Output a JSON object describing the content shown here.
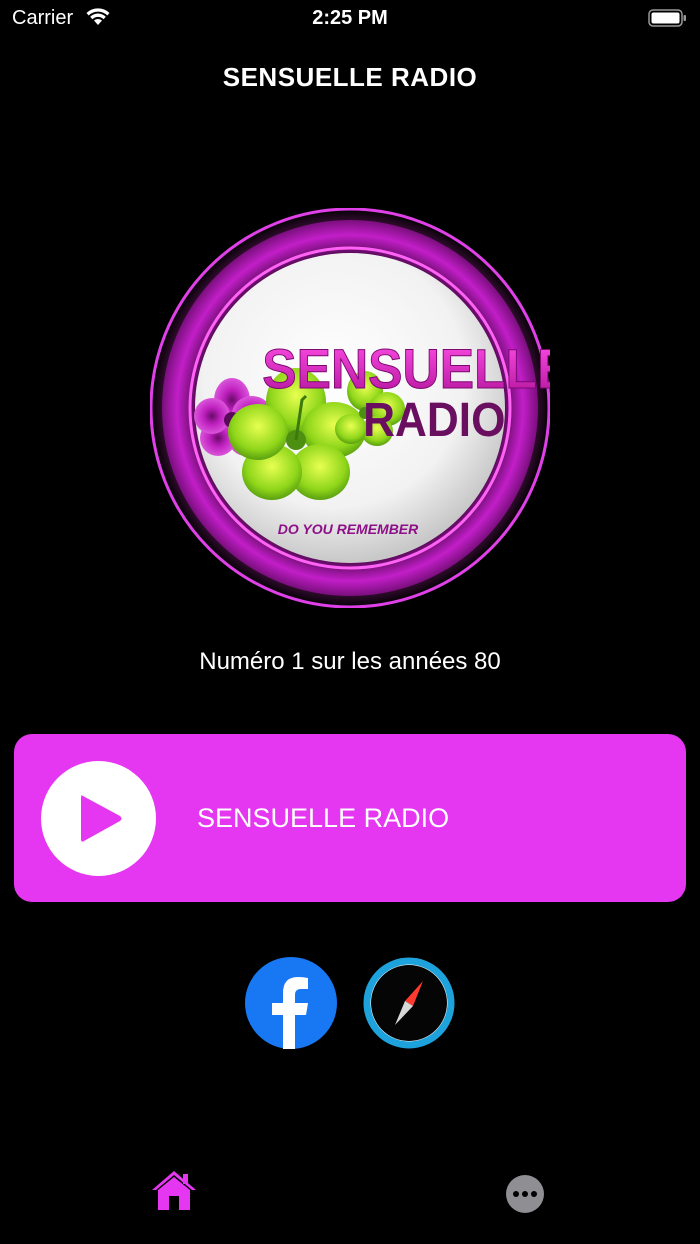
{
  "status_bar": {
    "carrier": "Carrier",
    "time": "2:25 PM"
  },
  "header": {
    "title": "SENSUELLE RADIO"
  },
  "logo": {
    "line1": "SENSUELLE",
    "line2": "RADIO",
    "slogan": "DO YOU REMEMBER"
  },
  "tagline": "Numéro 1 sur les années 80",
  "player": {
    "station_name": "SENSUELLE RADIO"
  },
  "social": {
    "facebook_icon": "facebook-icon",
    "website_icon": "compass-icon"
  },
  "tabs": [
    {
      "icon": "home-icon",
      "active": true
    },
    {
      "icon": "more-icon",
      "active": false
    }
  ],
  "colors": {
    "accent": "#e536f2",
    "background": "#000000",
    "facebook": "#1877f2",
    "compass": "#1ea2dc"
  }
}
